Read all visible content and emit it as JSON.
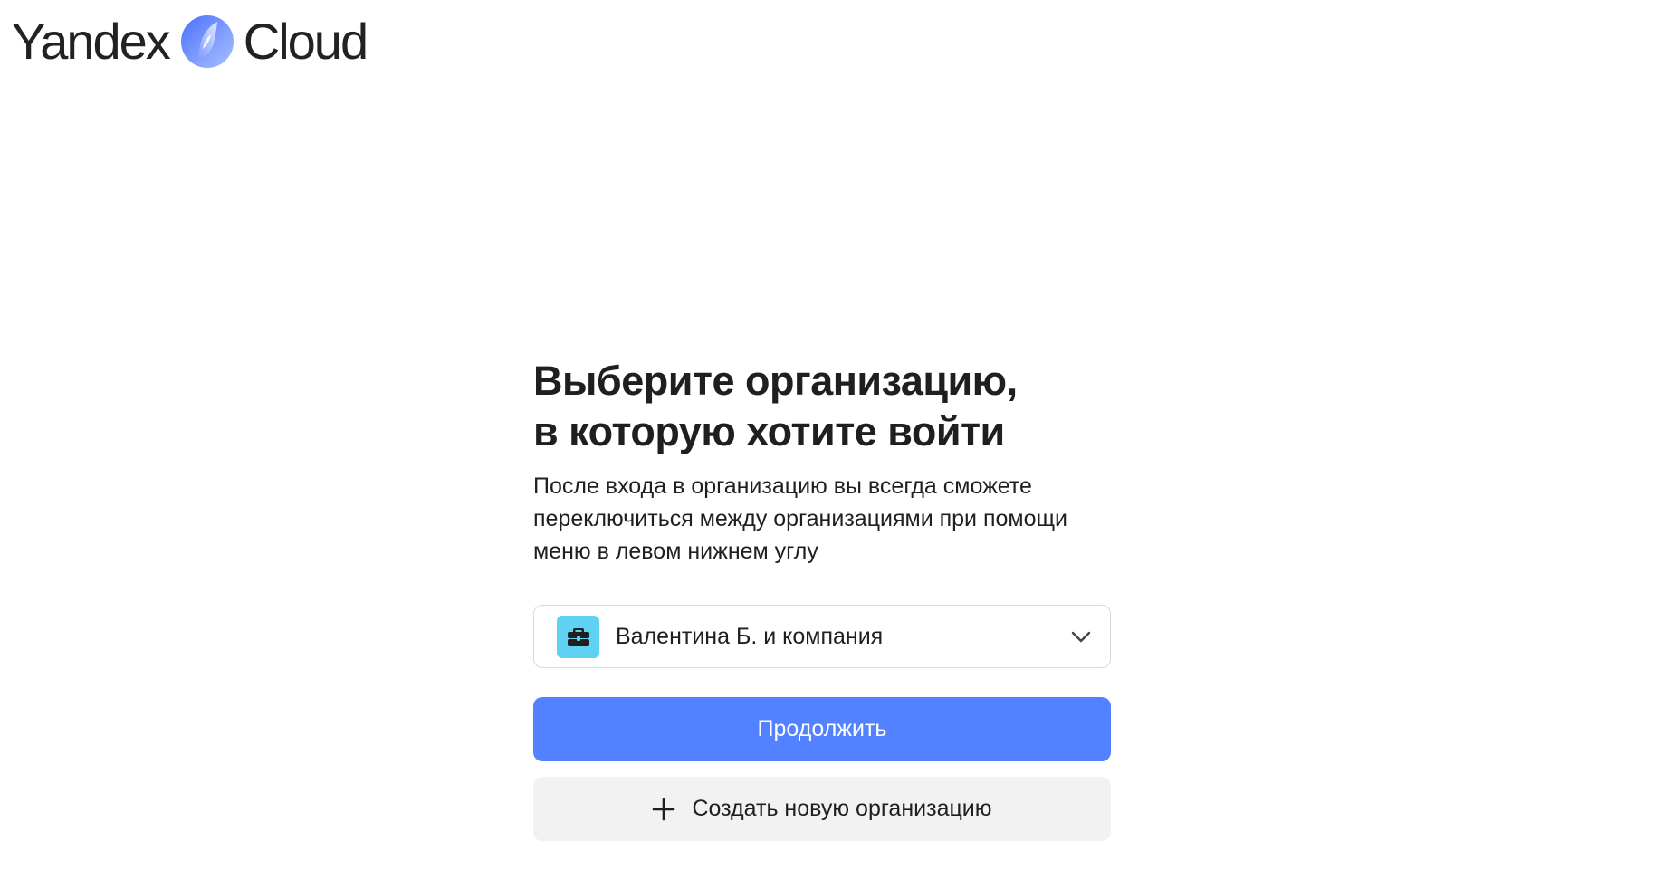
{
  "header": {
    "logo_left": "Yandex",
    "logo_right": "Cloud",
    "logo_icon": "yandex-cloud-logo-icon"
  },
  "main": {
    "title_line1": "Выберите организацию,",
    "title_line2": "в которую хотите войти",
    "description": "После входа в организацию вы всегда сможете переключиться между организациями при помощи меню в левом нижнем углу",
    "org_select": {
      "selected_value": "Валентина Б. и компания",
      "icon": "briefcase-icon",
      "badge_color": "#5fd1f2"
    },
    "continue_label": "Продолжить",
    "create_label": "Создать новую организацию"
  },
  "colors": {
    "primary": "#5282ff",
    "secondary_bg": "#f2f2f2",
    "logo_gradient_start": "#4b70ff",
    "logo_gradient_end": "#a9c1ff"
  }
}
